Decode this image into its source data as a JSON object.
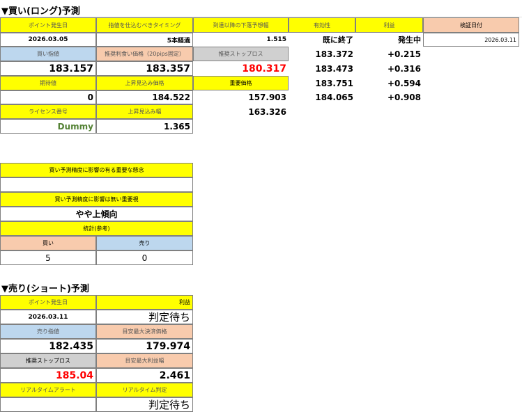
{
  "long": {
    "heading": "▼買い(ロング)予測",
    "headers": {
      "point_date": "ポイント発生日",
      "entry_timing": "指値を仕込むべきタイミング",
      "drop_forecast": "到達以降の下落予想幅",
      "validity": "有効性",
      "profit": "利益",
      "verify_date": "検証日付"
    },
    "values": {
      "point_date": "2026.03.05",
      "entry_timing": "5本経過",
      "drop_forecast": "1.515",
      "validity": "既に終了",
      "profit": "発生中",
      "verify_date": "2026.03.11"
    },
    "labels": {
      "buy_limit": "買い指値",
      "take_profit": "推奨利食い価格（20pips固定）",
      "stop_loss": "推奨ストップロス",
      "expected": "期待値",
      "rise_price": "上昇見込み価格",
      "important_price": "重要価格",
      "license": "ライセンス番号",
      "rise_width": "上昇見込み幅"
    },
    "buy_limit": "183.157",
    "take_profit": "183.357",
    "stop_loss": "180.317",
    "expected": "0",
    "rise_price": "184.522",
    "important_price": "157.903",
    "important_price2": "163.326",
    "license": "Dummy",
    "rise_width": "1.365",
    "ladder": [
      {
        "price": "183.372",
        "gain": "+0.215"
      },
      {
        "price": "183.473",
        "gain": "+0.316"
      },
      {
        "price": "183.751",
        "gain": "+0.594"
      },
      {
        "price": "184.065",
        "gain": "+0.908"
      }
    ],
    "factor_high_label": "買い予測精度に影響の有る重要な懸念",
    "factor_low_label": "買い予測精度に影響は無い重要視",
    "trend": "やや上傾向",
    "stats_label": "統計(参考)",
    "stats_buy_label": "買い",
    "stats_sell_label": "売り",
    "stats_buy": "5",
    "stats_sell": "0"
  },
  "short": {
    "heading": "▼売り(ショート)予測",
    "point_date_label": "ポイント発生日",
    "profit_label": "利益",
    "point_date": "2026.03.11",
    "profit": "判定待ち",
    "sell_limit_label": "売り指値",
    "target_label": "目安最大決済価格",
    "sell_limit": "182.435",
    "target": "179.974",
    "stop_loss_label": "推奨ストップロス",
    "max_profit_label": "目安最大利益幅",
    "stop_loss": "185.04",
    "max_profit": "2.461",
    "alert_label": "リアルタイムアラート",
    "judge_label": "リアルタイム判定",
    "alert": "",
    "judge": "判定待ち"
  }
}
